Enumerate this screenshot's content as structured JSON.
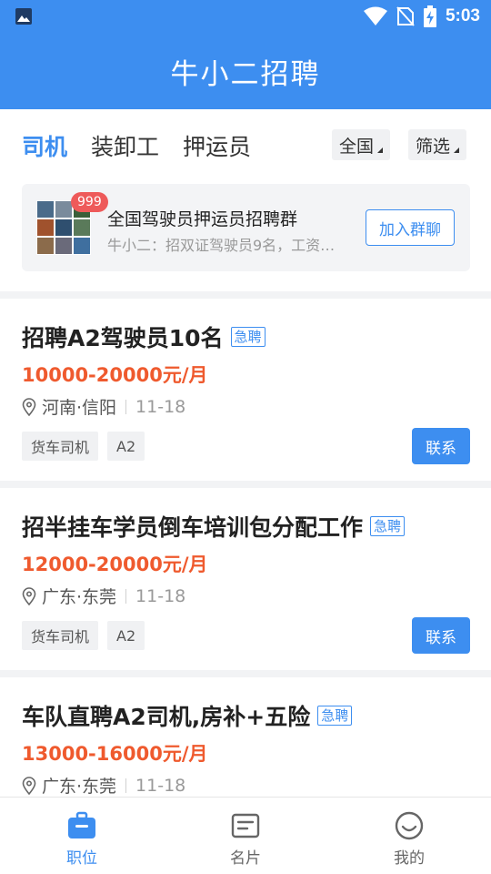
{
  "status_bar": {
    "time": "5:03"
  },
  "app": {
    "title": "牛小二招聘"
  },
  "tabs": [
    {
      "label": "司机",
      "active": true
    },
    {
      "label": "装卸工",
      "active": false
    },
    {
      "label": "押运员",
      "active": false
    }
  ],
  "filters": {
    "region": "全国",
    "filter": "筛选"
  },
  "group": {
    "badge": "999",
    "name": "全国驾驶员押运员招聘群",
    "last_message": "牛小二：招双证驾驶员9名，工资…",
    "join_label": "加入群聊"
  },
  "jobs": [
    {
      "title": "招聘A2驾驶员10名",
      "urgent": "急聘",
      "salary": "10000-20000元/月",
      "location": "河南·信阳",
      "date": "11-18",
      "tags": [
        "货车司机",
        "A2"
      ],
      "contact": "联系"
    },
    {
      "title": "招半挂车学员倒车培训包分配工作",
      "urgent": "急聘",
      "salary": "12000-20000元/月",
      "location": "广东·东莞",
      "date": "11-18",
      "tags": [
        "货车司机",
        "A2"
      ],
      "contact": "联系"
    },
    {
      "title": "车队直聘A2司机,房补+五险",
      "urgent": "急聘",
      "salary": "13000-16000元/月",
      "location": "广东·东莞",
      "date": "11-18",
      "tags": [],
      "contact": ""
    }
  ],
  "bottom_nav": [
    {
      "label": "职位",
      "icon": "briefcase-icon",
      "active": true
    },
    {
      "label": "名片",
      "icon": "card-icon",
      "active": false
    },
    {
      "label": "我的",
      "icon": "smiley-icon",
      "active": false
    }
  ],
  "colors": {
    "primary": "#3d8ef0",
    "salary": "#ef5a2e",
    "badge": "#ee5a5a"
  }
}
